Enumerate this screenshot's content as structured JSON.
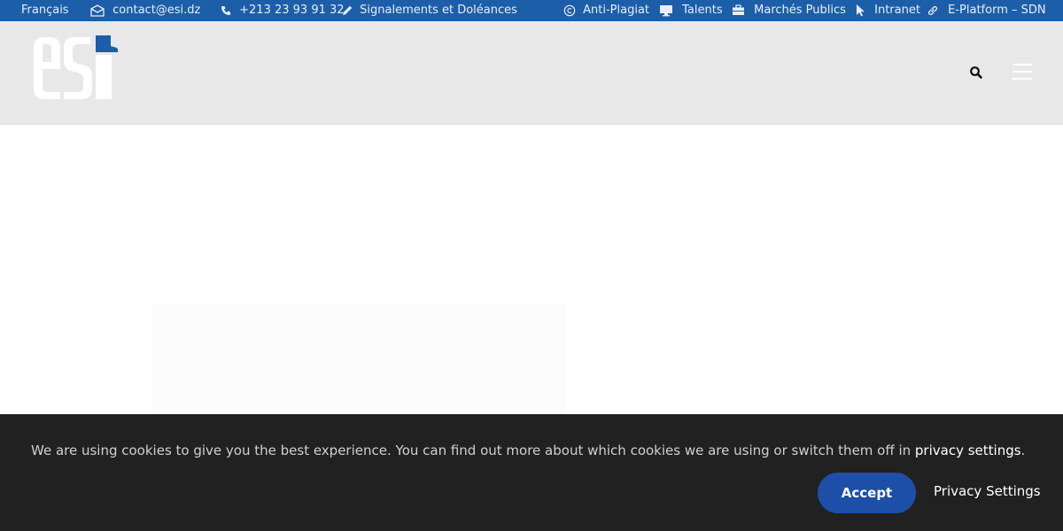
{
  "topbar": {
    "language": "Français",
    "email": "contact@esi.dz",
    "phone": "+213 23 93 91 32",
    "reports": "Signalements et Doléances",
    "links": [
      {
        "label": "Anti-Plagiat",
        "icon": "copyright-icon"
      },
      {
        "label": "Talents",
        "icon": "monitor-icon"
      },
      {
        "label": "Marchés Publics",
        "icon": "briefcase-icon"
      },
      {
        "label": "Intranet",
        "icon": "cursor-icon"
      },
      {
        "label": "E-Platform – SDN",
        "icon": "link-icon"
      }
    ],
    "colors": {
      "background": "#1d5ea8",
      "text": "#e8eef7"
    }
  },
  "header": {
    "logo_text": "esi",
    "search_icon": "search-icon",
    "menu_icon": "hamburger-menu-icon",
    "colors": {
      "background": "#e8e8e8"
    }
  },
  "cookie_banner": {
    "message": "We are using cookies to give you the best experience. You can find out more about which cookies we are using or switch them off in ",
    "link_label": "privacy settings",
    "message_end": ".",
    "accept_label": "Accept",
    "privacy_settings_label": "Privacy Settings",
    "colors": {
      "background": "#212121",
      "accent": "#1d4fa8"
    }
  }
}
